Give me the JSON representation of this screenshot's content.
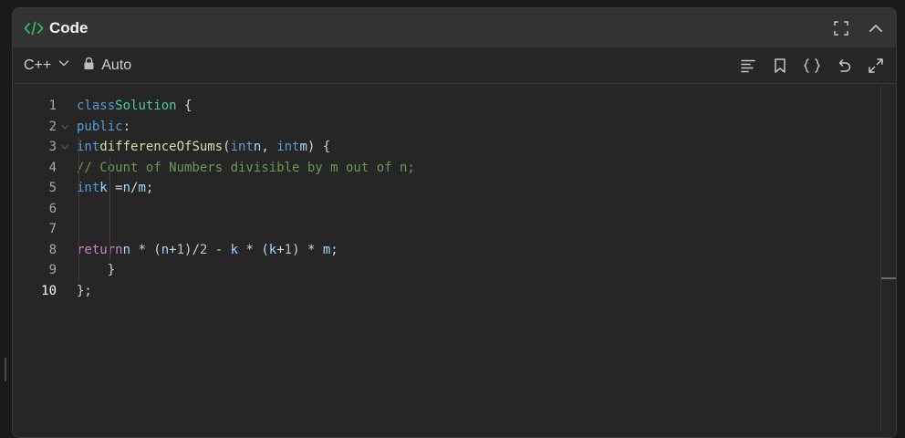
{
  "panel": {
    "title": "Code",
    "accent": "#2cbb5d"
  },
  "toolbar": {
    "language": "C++",
    "mode": "Auto"
  },
  "icons": {
    "title": [
      "code-icon"
    ],
    "title_actions": [
      "fullscreen-icon",
      "collapse-icon"
    ],
    "toolbar_left": [
      "chevron-down-icon",
      "lock-icon"
    ],
    "toolbar_actions": [
      "format-icon",
      "bookmark-icon",
      "braces-icon",
      "reset-icon",
      "expand-icon"
    ]
  },
  "editor": {
    "line_numbers": [
      "1",
      "2",
      "3",
      "4",
      "5",
      "6",
      "7",
      "8",
      "9",
      "10"
    ],
    "current_line": "10"
  }
}
